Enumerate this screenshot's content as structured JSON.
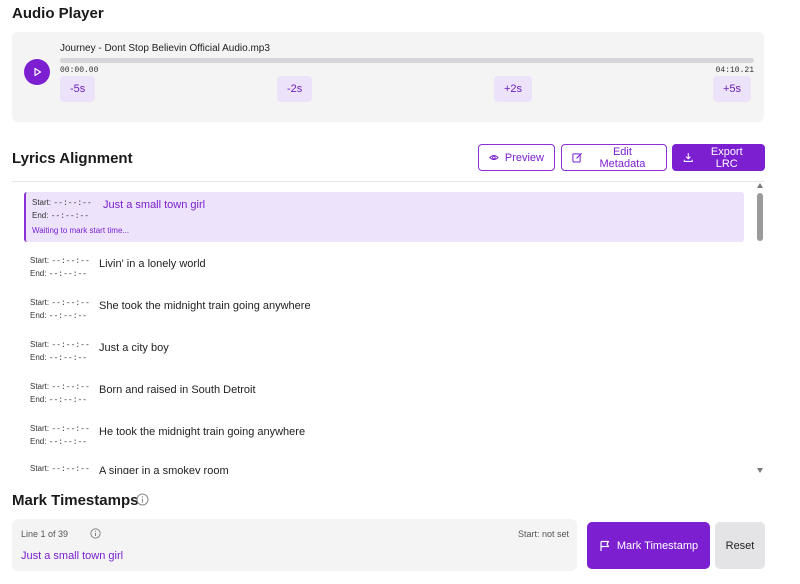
{
  "audio_player": {
    "title": "Audio Player",
    "track_name": "Journey - Dont Stop Believin Official Audio.mp3",
    "current_time": "00:00.00",
    "total_time": "04:10.21",
    "progress_fraction": 0,
    "seek_buttons": [
      "-5s",
      "-2s",
      "+2s",
      "+5s"
    ]
  },
  "lyrics_alignment": {
    "title": "Lyrics Alignment",
    "buttons": {
      "preview": "Preview",
      "edit_metadata": "Edit Metadata",
      "export_lrc": "Export LRC"
    },
    "start_label": "Start:",
    "end_label": "End:",
    "unset_time": "--:--:--",
    "status_waiting": "Waiting to mark start time...",
    "lines": [
      "Just a small town girl",
      "Livin' in a lonely world",
      "She took the midnight train going anywhere",
      "Just a city boy",
      "Born and raised in South Detroit",
      "He took the midnight train going anywhere",
      "A singer in a smokey room"
    ]
  },
  "mark_timestamps": {
    "title": "Mark Timestamps",
    "line_counter": "Line 1 of 39",
    "start_status": "Start: not set",
    "current_lyric": "Just a small town girl",
    "mark_button": "Mark Timestamp",
    "reset_button": "Reset"
  },
  "colors": {
    "accent": "#7c1fd1",
    "accent_light": "#ede3fb",
    "panel_bg": "#f4f4f5"
  }
}
